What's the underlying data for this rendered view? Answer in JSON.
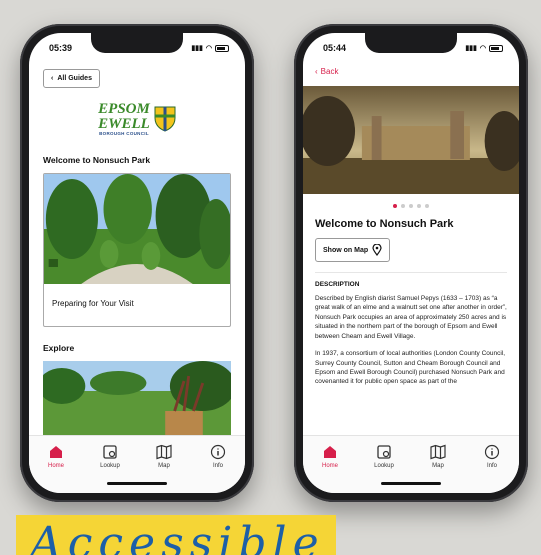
{
  "left_phone": {
    "time": "05:39",
    "back_label": "All Guides",
    "logo_line1": "EPSOM",
    "logo_line2": "EWELL",
    "logo_sub": "BOROUGH COUNCIL",
    "section_title": "Welcome to Nonsuch Park",
    "card_label": "Preparing for Your Visit",
    "explore_title": "Explore"
  },
  "right_phone": {
    "time": "05:44",
    "back_label": "Back",
    "title": "Welcome to Nonsuch Park",
    "map_button": "Show on Map",
    "description_heading": "DESCRIPTION",
    "para1": "Described by English diarist Samuel Pepys (1633 – 1703) as “a great walk of an elme and a walnutt set one after another in order”, Nonsuch Park occupies an area of approximately 250 acres and is situated in the northern part of the borough of Epsom and Ewell between Cheam and Ewell Village.",
    "para2": "In 1937, a consortium of local authorities (London County Council, Surrey County Council, Sutton and Cheam Borough Council and Epsom and Ewell Borough Council) purchased Nonsuch Park and covenanted it for public open space as part of the"
  },
  "tabs": [
    "Home",
    "Lookup",
    "Map",
    "Info"
  ],
  "banner_text": "Accessible",
  "colors": {
    "accent": "#d61f4a",
    "logo_green": "#3a8a2a",
    "banner": "#f5d536"
  }
}
